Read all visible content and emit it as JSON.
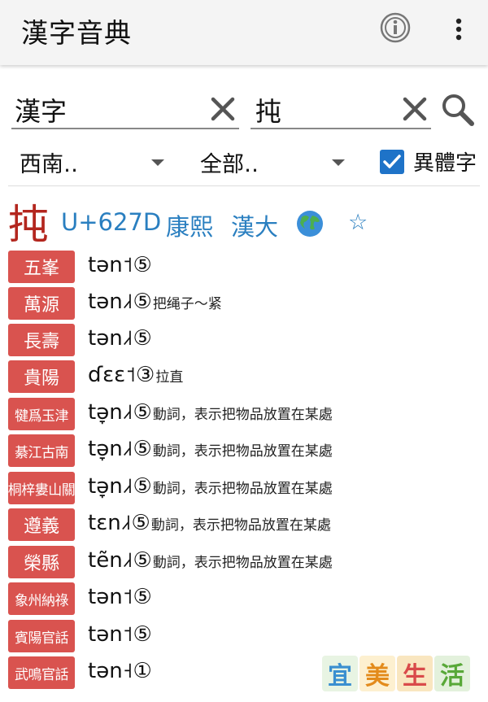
{
  "app": {
    "title": "漢字音典"
  },
  "search": {
    "field1_value": "漢字",
    "field2_value": "扽"
  },
  "filters": {
    "region": "西南‥",
    "scope": "全部‥",
    "variants_label": "異體字",
    "variants_checked": true
  },
  "entry": {
    "character": "扽",
    "codepoint": "U+627D",
    "kangxi": "康熙",
    "handa": "漢大",
    "star": "☆",
    "globe_icon": "globe-icon"
  },
  "readings": [
    {
      "place": "五峯",
      "pron": "tən˦⑤",
      "note": ""
    },
    {
      "place": "萬源",
      "pron": "tən˩˧⑤",
      "note": "把绳子～紧"
    },
    {
      "place": "長壽",
      "pron": "tən˩˧⑤",
      "note": ""
    },
    {
      "place": "貴陽",
      "pron": "ɗɛɛ˦③",
      "note": "拉直"
    },
    {
      "place": "犍爲玉津",
      "pron": "tə̞n˩˧⑤",
      "note": "動詞，表示把物品放置在某處"
    },
    {
      "place": "綦江古南",
      "pron": "tə̞n˩˧⑤",
      "note": "動詞，表示把物品放置在某處"
    },
    {
      "place": "桐梓婁山關",
      "pron": "tə̞n˩˧⑤",
      "note": "動詞，表示把物品放置在某處"
    },
    {
      "place": "遵義",
      "pron": "tɛn˩˧⑤",
      "note": "動詞，表示把物品放置在某處"
    },
    {
      "place": "榮縣",
      "pron": "tẽn˩˧⑤",
      "note": "動詞，表示把物品放置在某處"
    },
    {
      "place": "象州納祿",
      "pron": "tən˦⑤",
      "note": ""
    },
    {
      "place": "賓陽官話",
      "pron": "tən˦⑤",
      "note": ""
    },
    {
      "place": "武鳴官話",
      "pron": "tən˧①",
      "note": ""
    }
  ],
  "logo": {
    "chars": [
      "宜",
      "美",
      "生",
      "活"
    ]
  },
  "colors": {
    "accent_blue": "#2a7fc0",
    "badge_red": "#d9534f",
    "head_red": "#b3261e",
    "checkbox_blue": "#1e73c8"
  }
}
